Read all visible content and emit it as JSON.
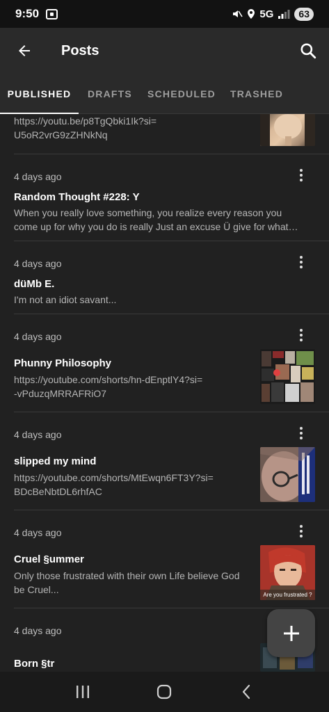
{
  "status_bar": {
    "time": "9:50",
    "network": "5G",
    "battery": "63"
  },
  "app_bar": {
    "title": "Posts"
  },
  "tabs": [
    {
      "label": "PUBLISHED",
      "active": true
    },
    {
      "label": "DRAFTS",
      "active": false
    },
    {
      "label": "SCHEDULED",
      "active": false
    },
    {
      "label": "TRASHED",
      "active": false
    }
  ],
  "posts": [
    {
      "date": "",
      "title": "",
      "body_line1": "https://youtu.be/p8TgQbki1Ik?si=",
      "body_line2": "U5oR2vrG9zZHNkNq",
      "has_thumb": true,
      "thumb": "tan-figure"
    },
    {
      "date": "4 days ago",
      "title": "Random Thought #228: Y",
      "body_line1": "When you really love something, you realize every reason you",
      "body_line2": "come up for why you do is really Just an excuse Ü give for what…",
      "has_thumb": false
    },
    {
      "date": "4 days ago",
      "title": "düMb E.",
      "body_line1": "I'm not an idiot savant...",
      "body_line2": "",
      "has_thumb": false
    },
    {
      "date": "4 days ago",
      "title": "Phunny Philosophy",
      "body_line1": "https://youtube.com/shorts/hn-dEnptlY4?si=",
      "body_line2": "-vPduzqMRRAFRiO7",
      "has_thumb": true,
      "thumb": "collage"
    },
    {
      "date": "4 days ago",
      "title": "slipped my mind",
      "body_line1": "https://youtube.com/shorts/MtEwqn6FT3Y?si=",
      "body_line2": "BDcBeNbtDL6rhfAC",
      "has_thumb": true,
      "thumb": "glasses-face"
    },
    {
      "date": "4 days ago",
      "title": "Cruel §ummer",
      "body_line1": "Only those frustrated with their own Life believe God",
      "body_line2": "be Cruel...",
      "has_thumb": true,
      "thumb": "anime",
      "thumb_caption": "Are you frustrated ?"
    },
    {
      "date": "4 days ago",
      "title": "Born §tr",
      "body_line1": "",
      "body_line2": "",
      "has_thumb": true,
      "thumb": "dark-collage"
    }
  ],
  "fab": {
    "icon": "plus-icon"
  },
  "nav_bar": {
    "icons": [
      "recent-apps-icon",
      "home-icon",
      "back-icon"
    ]
  },
  "colors": {
    "background": "#212121",
    "app_bar": "#2a2a2a",
    "status_bar": "#121212",
    "divider": "#3a3a3a",
    "text_primary": "#ffffff",
    "text_secondary": "#b5b5b5"
  }
}
